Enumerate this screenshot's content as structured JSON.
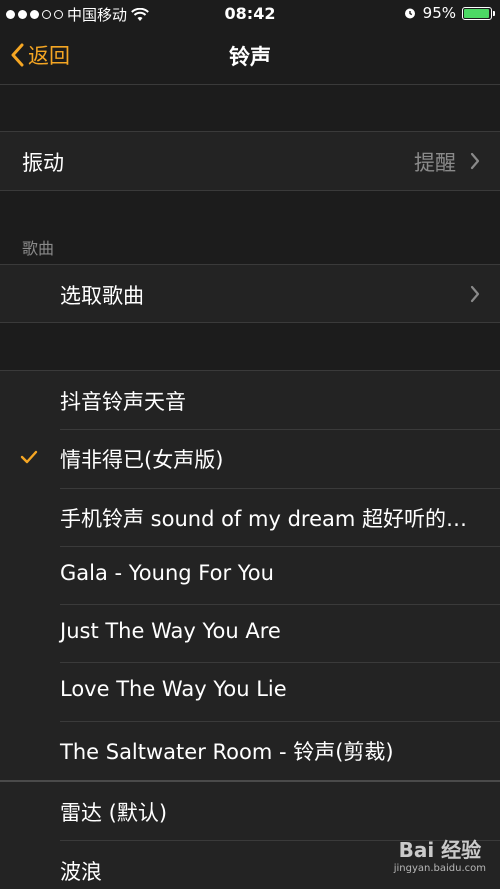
{
  "status_bar": {
    "carrier": "中国移动",
    "time": "08:42",
    "battery_percent": "95%",
    "battery_level": 0.95
  },
  "nav": {
    "back_label": "返回",
    "title": "铃声"
  },
  "vibration": {
    "label": "振动",
    "value": "提醒"
  },
  "songs_section": {
    "header": "歌曲",
    "pick_label": "选取歌曲"
  },
  "ringtones": [
    {
      "label": "抖音铃声天音",
      "selected": false
    },
    {
      "label": "情非得已(女声版)",
      "selected": true
    },
    {
      "label": "手机铃声 sound of my dream 超好听的…",
      "selected": false
    },
    {
      "label": "Gala - Young For You",
      "selected": false
    },
    {
      "label": "Just The Way You Are",
      "selected": false
    },
    {
      "label": "Love The Way You Lie",
      "selected": false
    },
    {
      "label": "The Saltwater Room - 铃声(剪裁)",
      "selected": false
    }
  ],
  "system_tones": [
    {
      "label": "雷达 (默认)"
    },
    {
      "label": "波浪"
    }
  ],
  "watermark": {
    "text": "Bai 经验",
    "sub": "jingyan.baidu.com"
  },
  "colors": {
    "accent": "#f5a623",
    "background": "#1c1c1c",
    "cell": "#232323",
    "separator": "#3a3a3a",
    "secondary_text": "#8a8a8a"
  }
}
